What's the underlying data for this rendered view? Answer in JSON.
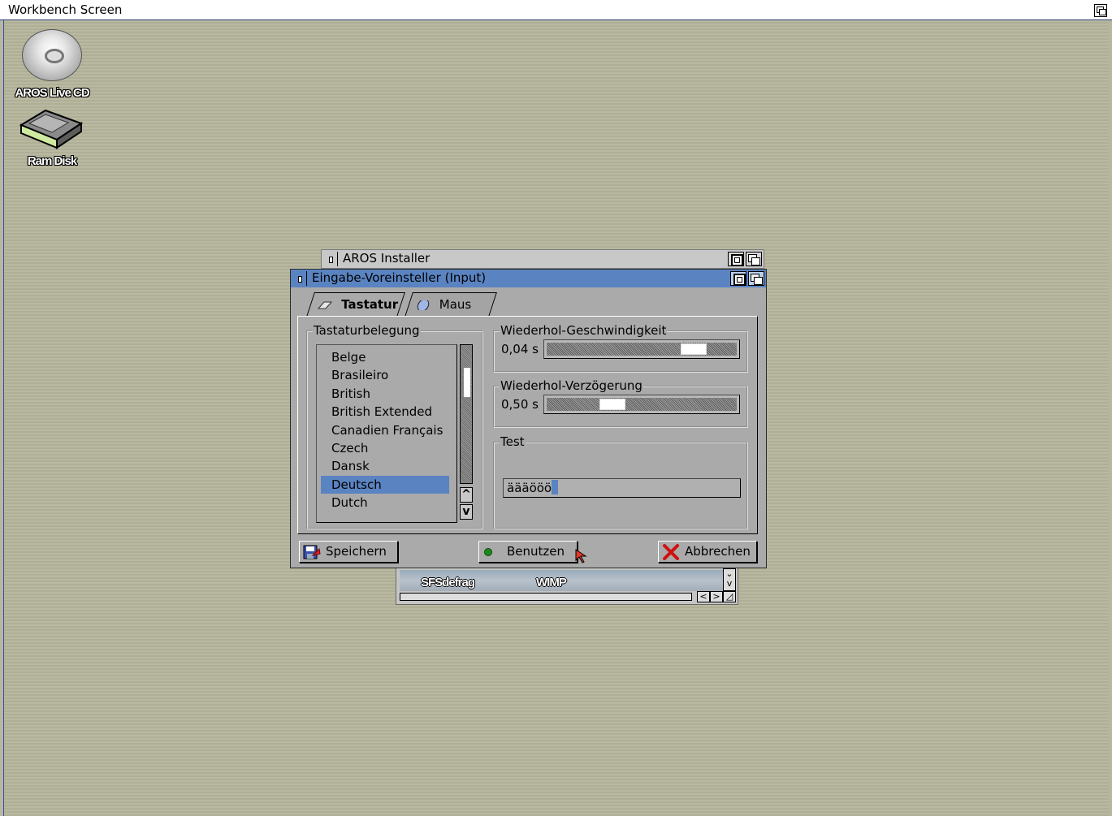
{
  "screen": {
    "title": "Workbench Screen"
  },
  "desktop_icons": [
    {
      "label": "AROS Live CD",
      "icon": "cd-disc-icon"
    },
    {
      "label": "Ram Disk",
      "icon": "ram-disk-icon"
    }
  ],
  "installer_window": {
    "title": "AROS Installer"
  },
  "background_window": {
    "items": [
      "SFSdefrag",
      "WIMP"
    ]
  },
  "prefs_window": {
    "title": "Eingabe-Voreinsteller (Input)",
    "tabs": [
      {
        "label": "Tastatur",
        "icon": "keyboard-icon",
        "active": true
      },
      {
        "label": "Maus",
        "icon": "mouse-icon",
        "active": false
      }
    ],
    "keymap_group": {
      "label": "Tastaturbelegung",
      "items": [
        "Belge",
        "Brasileiro",
        "British",
        "British Extended",
        "Canadien Français",
        "Czech",
        "Dansk",
        "Deutsch",
        "Dutch"
      ],
      "selected": "Deutsch"
    },
    "repeat_rate": {
      "label": "Wiederhol-Geschwindigkeit",
      "value": "0,04 s",
      "level": 0.82
    },
    "repeat_delay": {
      "label": "Wiederhol-Verzögerung",
      "value": "0,50 s",
      "level": 0.32
    },
    "test_group": {
      "label": "Test",
      "value": "äääööö"
    },
    "buttons": {
      "save": "Speichern",
      "use": "Benutzen",
      "cancel": "Abbrechen"
    }
  },
  "colors": {
    "accent": "#5a83c1",
    "desktop": "#b7b69e",
    "window": "#aaaaaa"
  }
}
